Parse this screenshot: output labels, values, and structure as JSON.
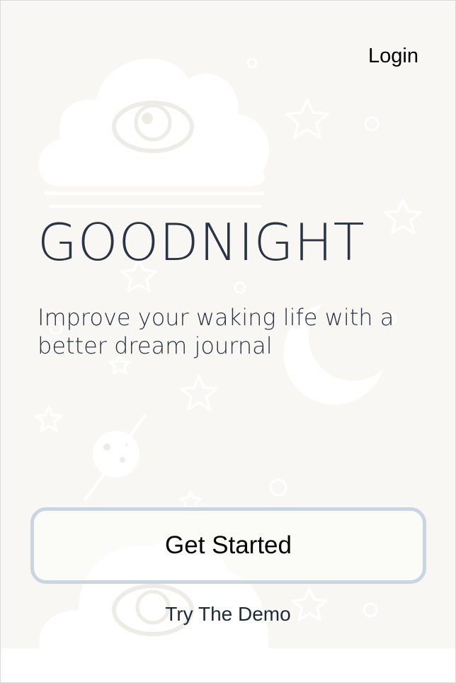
{
  "header": {
    "login_label": "Login"
  },
  "hero": {
    "title": "GOODNIGHT",
    "tagline": "Improve your waking life with a better dream journal"
  },
  "actions": {
    "get_started_label": "Get Started",
    "demo_label": "Try The Demo"
  },
  "colors": {
    "background": "#f8f7f3",
    "title_text": "#2a3444",
    "button_border": "#c9d5e3",
    "decor": "#ffffff"
  },
  "icons": {
    "background_illustrations": [
      "eye-cloud-icon",
      "star-icon",
      "crescent-moon-icon",
      "planet-icon",
      "circle-icon"
    ]
  }
}
